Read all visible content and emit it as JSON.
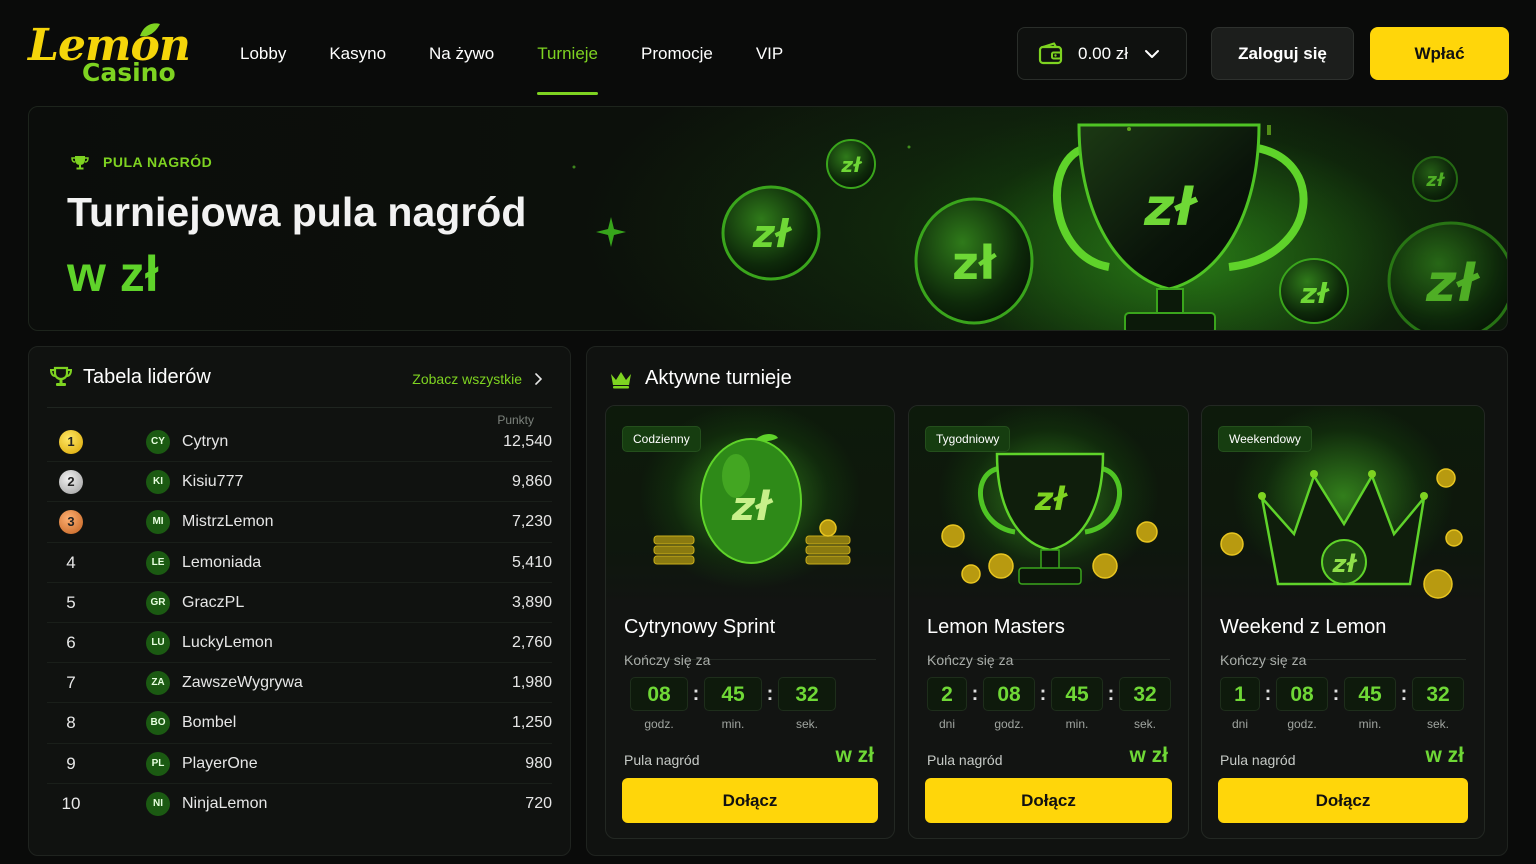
{
  "brand": {
    "logo_top": "Lemon",
    "logo_bottom": "Casino"
  },
  "nav": {
    "items": [
      {
        "label": "Lobby",
        "active": false
      },
      {
        "label": "Kasyno",
        "active": false
      },
      {
        "label": "Na żywo",
        "active": false
      },
      {
        "label": "Turnieje",
        "active": true
      },
      {
        "label": "Promocje",
        "active": false
      },
      {
        "label": "VIP",
        "active": false
      }
    ]
  },
  "wallet": {
    "amount": "0.00 zł",
    "icon": "wallet-icon"
  },
  "auth": {
    "login_label": "Zaloguj się",
    "deposit_label": "Wpłać"
  },
  "hero": {
    "tag": "PULA NAGRÓD",
    "title": "Turniejowa pula nagród",
    "subtitle": "w zł",
    "coin_glyph": "zł"
  },
  "leaderboard": {
    "title": "Tabela liderów",
    "see_all": "Zobacz wszystkie",
    "points_header": "Punkty",
    "rows": [
      {
        "rank": "1",
        "initials": "CY",
        "name": "Cytryn",
        "points": "12,540"
      },
      {
        "rank": "2",
        "initials": "KI",
        "name": "Kisiu777",
        "points": "9,860"
      },
      {
        "rank": "3",
        "initials": "MI",
        "name": "MistrzLemon",
        "points": "7,230"
      },
      {
        "rank": "4",
        "initials": "LE",
        "name": "Lemoniada",
        "points": "5,410"
      },
      {
        "rank": "5",
        "initials": "GR",
        "name": "GraczPL",
        "points": "3,890"
      },
      {
        "rank": "6",
        "initials": "LU",
        "name": "LuckyLemon",
        "points": "2,760"
      },
      {
        "rank": "7",
        "initials": "ZA",
        "name": "ZawszeWygrywa",
        "points": "1,980"
      },
      {
        "rank": "8",
        "initials": "BO",
        "name": "Bombel",
        "points": "1,250"
      },
      {
        "rank": "9",
        "initials": "PL",
        "name": "PlayerOne",
        "points": "980"
      },
      {
        "rank": "10",
        "initials": "NI",
        "name": "NinjaLemon",
        "points": "720"
      }
    ]
  },
  "tournaments": {
    "title": "Aktywne turnieje",
    "ends_label": "Kończy się za",
    "pool_label": "Pula nagród",
    "join_label": "Dołącz",
    "cards": [
      {
        "badge": "Codzienny",
        "title": "Cytrynowy Sprint",
        "art": "lemon-coin-art",
        "art_glyph": "zł",
        "timer": [
          {
            "value": "08",
            "label": "godz."
          },
          {
            "value": "45",
            "label": "min."
          },
          {
            "value": "32",
            "label": "sek."
          }
        ],
        "pool_value": "w zł"
      },
      {
        "badge": "Tygodniowy",
        "title": "Lemon Masters",
        "art": "trophy-art",
        "art_glyph": "zł",
        "timer": [
          {
            "value": "2",
            "label": "dni"
          },
          {
            "value": "08",
            "label": "godz."
          },
          {
            "value": "45",
            "label": "min."
          },
          {
            "value": "32",
            "label": "sek."
          }
        ],
        "pool_value": "w zł"
      },
      {
        "badge": "Weekendowy",
        "title": "Weekend z Lemon",
        "art": "crown-art",
        "art_glyph": "zł",
        "timer": [
          {
            "value": "1",
            "label": "dni"
          },
          {
            "value": "08",
            "label": "godz."
          },
          {
            "value": "45",
            "label": "min."
          },
          {
            "value": "32",
            "label": "sek."
          }
        ],
        "pool_value": "w zł"
      }
    ]
  },
  "colors": {
    "accent_green": "#7ed321",
    "accent_yellow": "#ffd60a",
    "background": "#0a0b0a",
    "panel": "#101210"
  }
}
